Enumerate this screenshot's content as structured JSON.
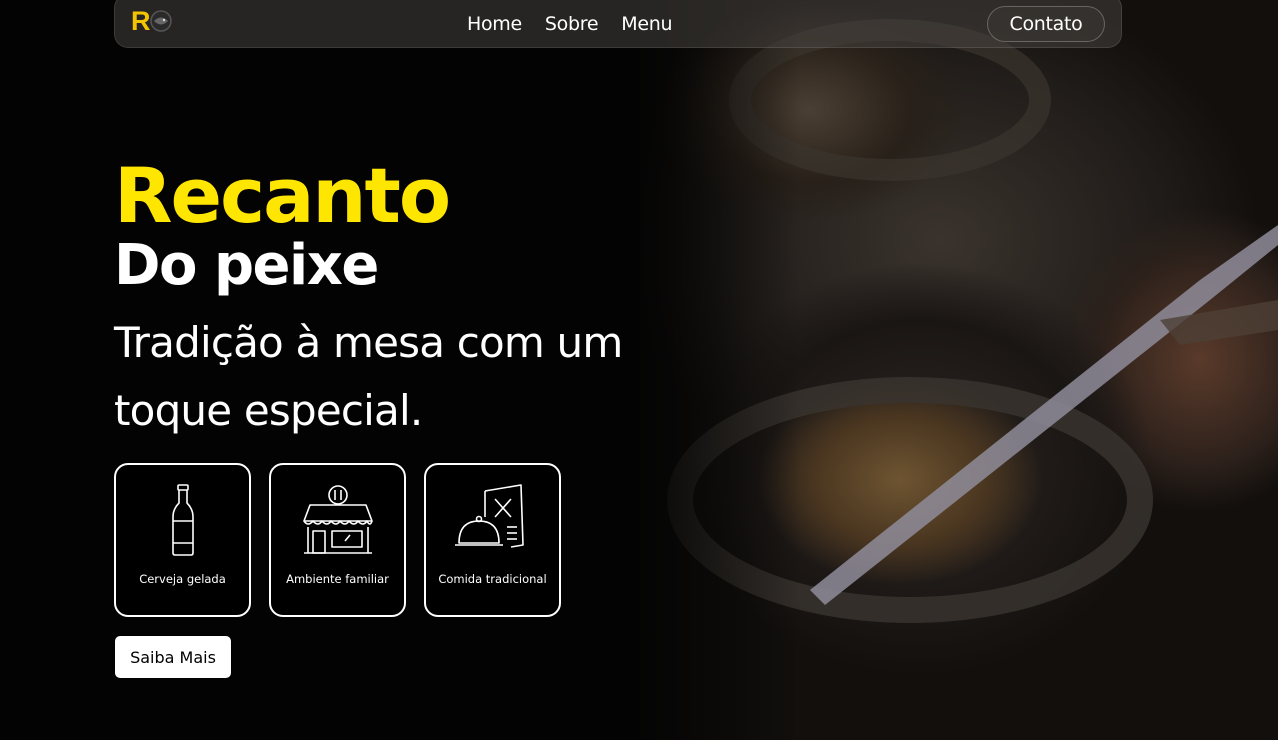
{
  "brand": {
    "logo_letter": "R",
    "accent_color": "#ffe600"
  },
  "nav": {
    "links": [
      "Home",
      "Sobre",
      "Menu"
    ],
    "contact_label": "Contato"
  },
  "hero": {
    "title": "Recanto",
    "subtitle": "Do peixe",
    "tagline": "Tradição à mesa com um toque especial."
  },
  "features": [
    {
      "icon": "beer-bottle-icon",
      "label": "Cerveja gelada"
    },
    {
      "icon": "storefront-icon",
      "label": "Ambiente familiar"
    },
    {
      "icon": "cloche-menu-icon",
      "label": "Comida tradicional"
    }
  ],
  "cta": {
    "label": "Saiba Mais"
  }
}
